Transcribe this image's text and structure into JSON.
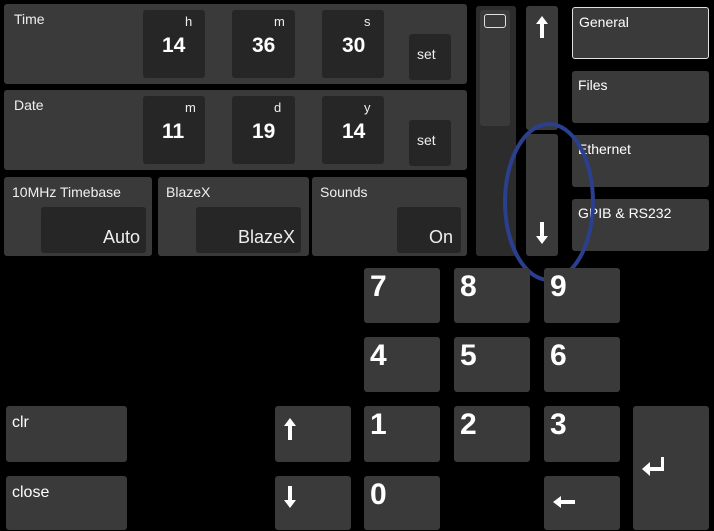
{
  "time": {
    "label": "Time",
    "hour_label": "h",
    "minute_label": "m",
    "second_label": "s",
    "hour": "14",
    "minute": "36",
    "second": "30",
    "set_label": "set"
  },
  "date": {
    "label": "Date",
    "month_label": "m",
    "day_label": "d",
    "year_label": "y",
    "month": "11",
    "day": "19",
    "year": "14",
    "set_label": "set"
  },
  "timebase": {
    "label": "10MHz Timebase",
    "value": "Auto"
  },
  "blazex": {
    "label": "BlazeX",
    "value": "BlazeX"
  },
  "sounds": {
    "label": "Sounds",
    "value": "On"
  },
  "sidebar": {
    "items": [
      {
        "label": "General",
        "selected": true
      },
      {
        "label": "Files"
      },
      {
        "label": "Ethernet"
      },
      {
        "label": "GPIB & RS232"
      }
    ]
  },
  "keypad": {
    "k7": "7",
    "k8": "8",
    "k9": "9",
    "k4": "4",
    "k5": "5",
    "k6": "6",
    "k1": "1",
    "k2": "2",
    "k3": "3",
    "k0": "0"
  },
  "buttons": {
    "clr": "clr",
    "close": "close"
  },
  "icons": {
    "scroll_up": "up-arrow-icon",
    "scroll_down": "down-arrow-icon",
    "enter": "enter-icon",
    "backspace": "left-arrow-icon"
  },
  "colors": {
    "panel": "#3a3a3a",
    "field": "#262626",
    "highlight_circle": "#2b3f8f"
  }
}
